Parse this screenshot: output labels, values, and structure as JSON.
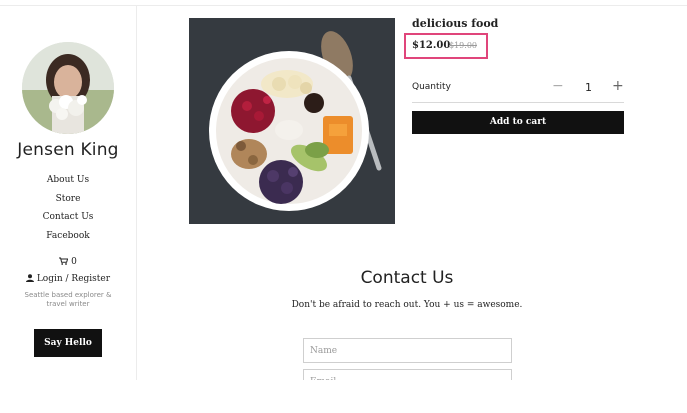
{
  "sidebar": {
    "brand": "Jensen King",
    "nav": [
      "About Us",
      "Store",
      "Contact Us",
      "Facebook"
    ],
    "cart_count": "0",
    "cart_icon": "cart-icon",
    "user_icon": "user-icon",
    "login_label": "Login / Register",
    "tagline": "Seattle based explorer & travel writer",
    "say_hello": "Say Hello"
  },
  "product": {
    "title": "delicious food",
    "price": "$12.00",
    "old_price": "$19.00",
    "quantity_label": "Quantity",
    "quantity": "1",
    "minus": "−",
    "plus": "+",
    "add_to_cart": "Add to cart",
    "highlight_color": "#e0457b"
  },
  "contact": {
    "heading": "Contact Us",
    "subtitle": "Don't be afraid to reach out. You + us = awesome.",
    "name_placeholder": "Name",
    "email_placeholder": "Email"
  }
}
